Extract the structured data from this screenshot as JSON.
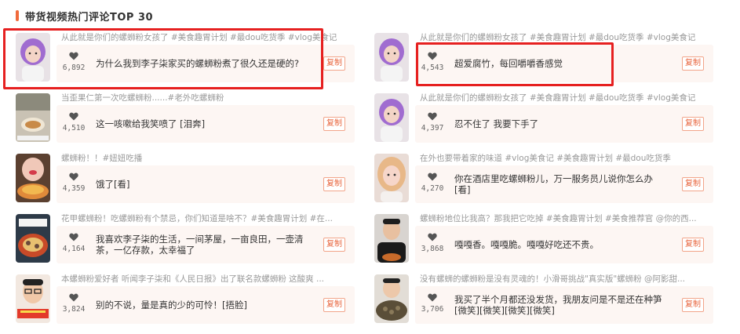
{
  "section": {
    "title": "带货视频热门评论TOP 30",
    "accent_color": "#f06a3c",
    "highlight_color": "#e62020"
  },
  "copy_label": "复制",
  "left": [
    {
      "video_title": "从此就是你们的螺蛳粉女孩了 #美食趣胃计划 #最dou吃货季 #vlog美食记",
      "likes": "6,892",
      "comment": "为什么我到李子柒家买的螺蛳粉煮了很久还是硬的?",
      "thumb": "purple-hair-girl",
      "highlighted": true
    },
    {
      "video_title": "当歪果仁第一次吃螺蛳粉......#老外吃螺蛳粉",
      "likes": "4,510",
      "comment": "这一咳嗽给我笑喷了 [泪奔]",
      "thumb": "foreigner-eating",
      "highlighted": false
    },
    {
      "video_title": "螺蛳粉！！#妞妞吃播",
      "likes": "4,359",
      "comment": "饿了[看]",
      "thumb": "girl-eating-noodles",
      "highlighted": false
    },
    {
      "video_title": "花甲螺蛳粉！吃螺蛳粉有个禁忌，你们知道是啥不？#美食趣胃计划 #在...",
      "likes": "4,164",
      "comment": "我喜欢李子柒的生活，一间茅屋，一亩良田，一壶清茶，一亿存款，太幸福了",
      "thumb": "clam-noodle-bowl",
      "highlighted": false
    },
    {
      "video_title": "本螺蛳粉爱好者 听闻李子柒和《人民日报》出了联名款螺蛳粉 这酸爽 ...",
      "likes": "3,824",
      "comment": "别的不说，量是真的少的可怜！[捂脸]",
      "thumb": "man-with-glasses",
      "highlighted": false
    }
  ],
  "right": [
    {
      "video_title": "从此就是你们的螺蛳粉女孩了 #美食趣胃计划 #最dou吃货季 #vlog美食记",
      "likes": "4,543",
      "comment": "超爱腐竹，每回嚼嚼香感觉",
      "thumb": "purple-hair-girl",
      "highlighted": true
    },
    {
      "video_title": "从此就是你们的螺蛳粉女孩了 #美食趣胃计划 #最dou吃货季 #vlog美食记",
      "likes": "4,397",
      "comment": "忍不住了 我要下手了",
      "thumb": "purple-hair-girl",
      "highlighted": false
    },
    {
      "video_title": "在外也要带着家的味道 #vlog美食记 #美食趣胃计划 #最dou吃货季",
      "likes": "4,270",
      "comment": "你在酒店里吃螺蛳粉儿，万一服务员儿说你怎么办[看]",
      "thumb": "blonde-girl",
      "highlighted": false
    },
    {
      "video_title": "螺蛳粉地位比我高？那我把它吃掉 #美食趣胃计划 #美食推荐官 @你的西...",
      "likes": "3,868",
      "comment": "嘎嘎香。嘎嘎脆。嘎嘎好吃还不贵。",
      "thumb": "man-in-black",
      "highlighted": false
    },
    {
      "video_title": "没有螺蛳的螺蛳粉是没有灵魂的！小滑哥挑战\"真实版\"螺蛳粉 @阿影甜...",
      "likes": "3,706",
      "comment": "我买了半个月都还没发货，我朋友问是不是还在种笋[微笑][微笑][微笑][微笑]",
      "thumb": "man-with-snails",
      "highlighted": false
    }
  ]
}
